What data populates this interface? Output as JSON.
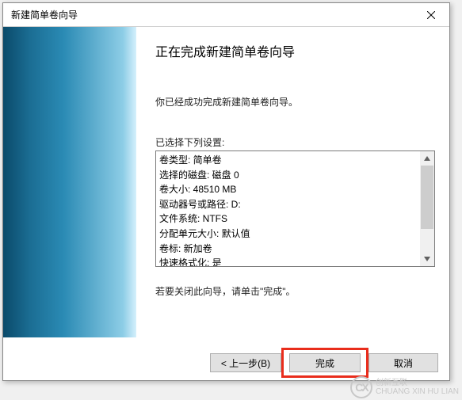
{
  "window": {
    "title": "新建简单卷向导"
  },
  "main": {
    "heading": "正在完成新建简单卷向导",
    "description": "你已经成功完成新建简单卷向导。",
    "settings_label": "已选择下列设置:",
    "settings": [
      "卷类型: 简单卷",
      "选择的磁盘: 磁盘 0",
      "卷大小: 48510 MB",
      "驱动器号或路径: D:",
      "文件系统: NTFS",
      "分配单元大小: 默认值",
      "卷标: 新加卷",
      "快速格式化: 是"
    ],
    "footer_note": "若要关闭此向导，请单击\"完成\"。"
  },
  "buttons": {
    "back": "< 上一步(B)",
    "finish": "完成",
    "cancel": "取消"
  },
  "watermark": {
    "logo": "CX",
    "line1": "创新互联",
    "line2": "CHUANG XIN HU LIAN"
  }
}
